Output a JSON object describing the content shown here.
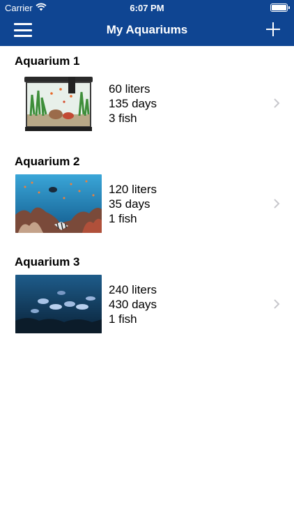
{
  "status_bar": {
    "carrier": "Carrier",
    "time": "6:07 PM"
  },
  "nav": {
    "title": "My Aquariums",
    "menu_icon": "hamburger-menu-icon",
    "add_icon": "plus-icon"
  },
  "colors": {
    "header": "#0f4592",
    "chevron": "#c7c7cc"
  },
  "aquariums": [
    {
      "title": "Aquarium 1",
      "volume": "60 liters",
      "age": "135 days",
      "fish": "3 fish",
      "thumb": "tank-photo"
    },
    {
      "title": "Aquarium 2",
      "volume": "120 liters",
      "age": "35 days",
      "fish": "1 fish",
      "thumb": "reef-photo"
    },
    {
      "title": "Aquarium 3",
      "volume": "240 liters",
      "age": "430 days",
      "fish": "1 fish",
      "thumb": "deep-sea-photo"
    }
  ]
}
